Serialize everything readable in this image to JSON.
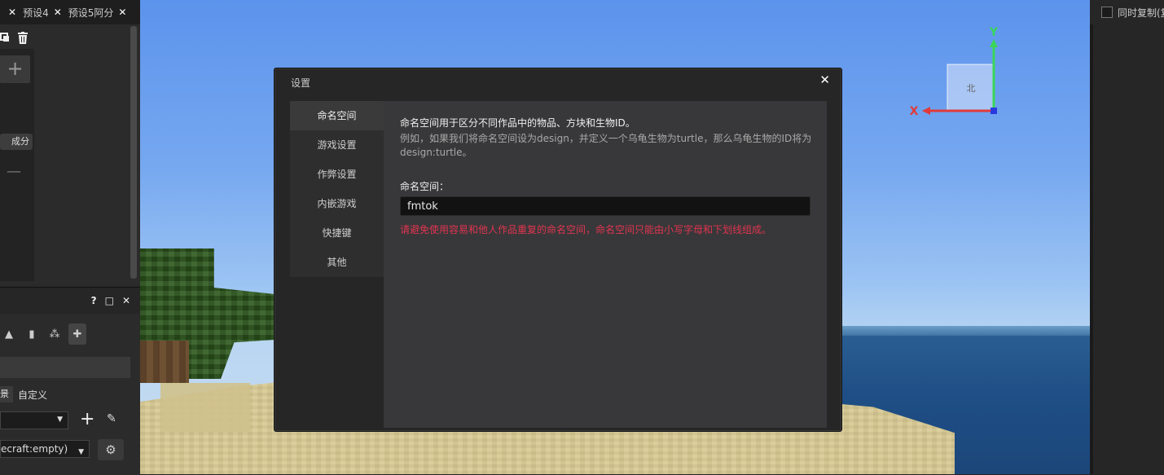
{
  "left_panel": {
    "tabs": [
      {
        "label": "",
        "close": "✕"
      },
      {
        "label": "预设4",
        "close": "✕"
      },
      {
        "label": "预设5阿分",
        "close": "✕"
      }
    ],
    "chip_label": "成分",
    "bottom_header": {
      "help": "?",
      "maximize": "□",
      "close": "✕"
    },
    "radio_partial": "景",
    "radio_custom": "自定义",
    "select2_value": "ecraft:empty)"
  },
  "right_panel": {
    "sync_copy_label": "同时复制(复"
  },
  "gizmo": {
    "north_label": "北",
    "x_label": "X",
    "y_label": "Y",
    "colors": {
      "x": "#e03a3a",
      "y": "#3ad65a",
      "z": "#2a3adf"
    }
  },
  "dialog": {
    "title": "设置",
    "close": "✕",
    "nav": [
      {
        "label": "命名空间",
        "active": true
      },
      {
        "label": "游戏设置",
        "active": false
      },
      {
        "label": "作弊设置",
        "active": false
      },
      {
        "label": "内嵌游戏",
        "active": false
      },
      {
        "label": "快捷键",
        "active": false
      },
      {
        "label": "其他",
        "active": false
      }
    ],
    "namespace": {
      "description": "命名空间用于区分不同作品中的物品、方块和生物ID。",
      "example": "例如，如果我们将命名空间设为design，并定义一个乌龟生物为turtle，那么乌龟生物的ID将为design:turtle。",
      "label": "命名空间：",
      "value": "fmtok",
      "warning": "请避免使用容易和他人作品重复的命名空间，命名空间只能由小写字母和下划线组成。",
      "warning_color": "#e0344f"
    }
  }
}
